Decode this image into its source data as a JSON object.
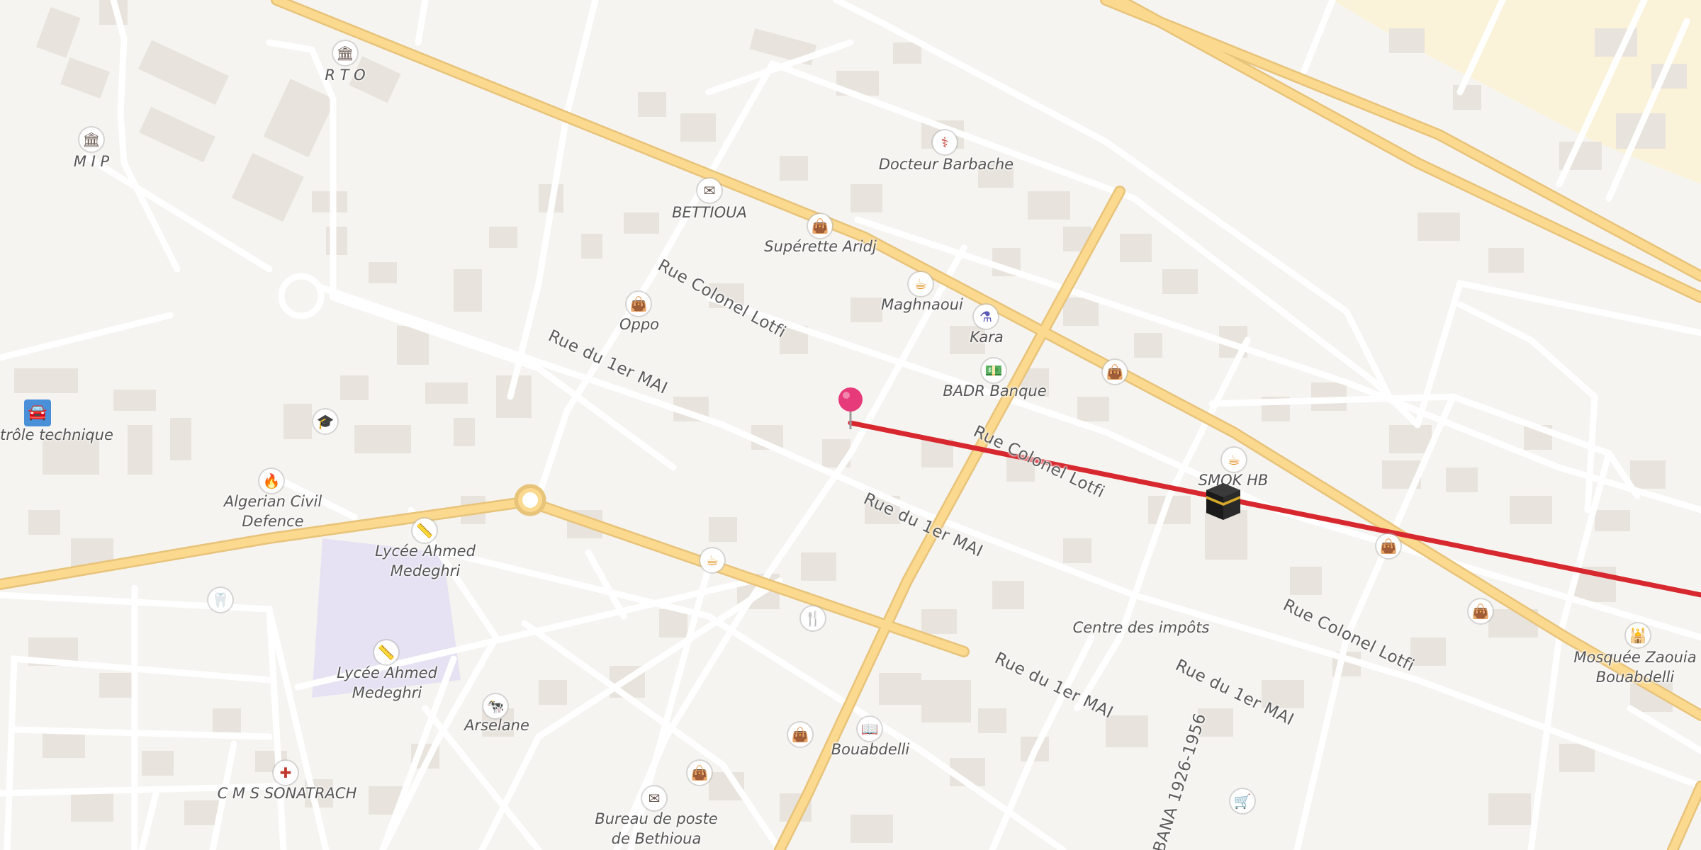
{
  "colors": {
    "background": "#f6f4f0",
    "building": "#e8e3dd",
    "minor_road": "#ffffff",
    "major_road": "#fbd98e",
    "major_road_edge": "#e8c37a",
    "school_area": "#e7e2f3",
    "route_line": "#d8282f",
    "pin": "#e73a7a",
    "shop_icon": "#5b58b8",
    "food_icon": "#e08a10",
    "admin_icon": "#6a5a52",
    "health_icon": "#c03a30"
  },
  "poi_labels": {
    "rto": "R T O",
    "mip": "M I P",
    "docteur": "Docteur Barbache",
    "bettioua": "BETTIOUA",
    "superette": "Supérette Aridj",
    "oppo": "Oppo",
    "maghnaoui": "Maghnaoui",
    "kara": "Kara",
    "badr": "BADR Banque",
    "smok": "SMOK HB",
    "controle": "trôle technique",
    "civil_defence": "Algerian Civil\nDefence",
    "lycee1": "Lycée Ahmed\nMedeghri",
    "lycee2": "Lycée Ahmed\nMedeghri",
    "arselane": "Arselane",
    "cms": "C M S SONATRACH",
    "bouabdelli": "Bouabdelli",
    "bureau": "Bureau de poste\nde Bethioua",
    "centre": "Centre des impôts",
    "mosquee": "Mosquée Zaouia\nBouabdelli"
  },
  "street_labels": {
    "colonel_1": "Rue Colonel Lotfi",
    "mai_1": "Rue du 1er MAI",
    "colonel_2": "Rue Colonel Lotfi",
    "mai_2": "Rue du 1er MAI",
    "colonel_3": "Rue Colonel Lotfi",
    "mai_3": "Rue du 1er MAI",
    "mai_4": "Rue du 1er MAI",
    "bana": "BANA 1926-1956"
  },
  "icons": {
    "rto": "government-building-icon",
    "mip": "government-building-icon",
    "docteur": "stethoscope-icon",
    "bettioua": "post-office-envelope-icon",
    "superette": "shopping-bag-icon",
    "oppo": "shopping-bag-icon",
    "maghnaoui": "cafe-cup-icon",
    "kara": "pharmacy-mortar-icon",
    "badr": "bank-banknote-icon",
    "shop_east": "shopping-bag-icon",
    "smok": "cafe-cup-icon",
    "car": "car-icon",
    "school": "graduation-cap-icon",
    "fire": "fire-station-icon",
    "lycee1": "school-ruler-icon",
    "lycee2": "school-ruler-icon",
    "dentist": "tooth-icon",
    "cafe_south": "cafe-cup-icon",
    "restaurant": "fork-knife-icon",
    "arselane": "butcher-cow-icon",
    "cms": "hospital-cross-icon",
    "shop_south1": "shopping-bag-icon",
    "shop_south2": "shopping-bag-icon",
    "bouabdelli": "library-book-icon",
    "bureau": "post-office-envelope-icon",
    "shop_far1": "shopping-bag-icon",
    "shop_far2": "shopping-bag-icon",
    "cart": "shopping-cart-icon",
    "mosque": "mosque-icon",
    "kaaba": "kaaba-qibla-icon",
    "pin": "location-pin-icon"
  }
}
